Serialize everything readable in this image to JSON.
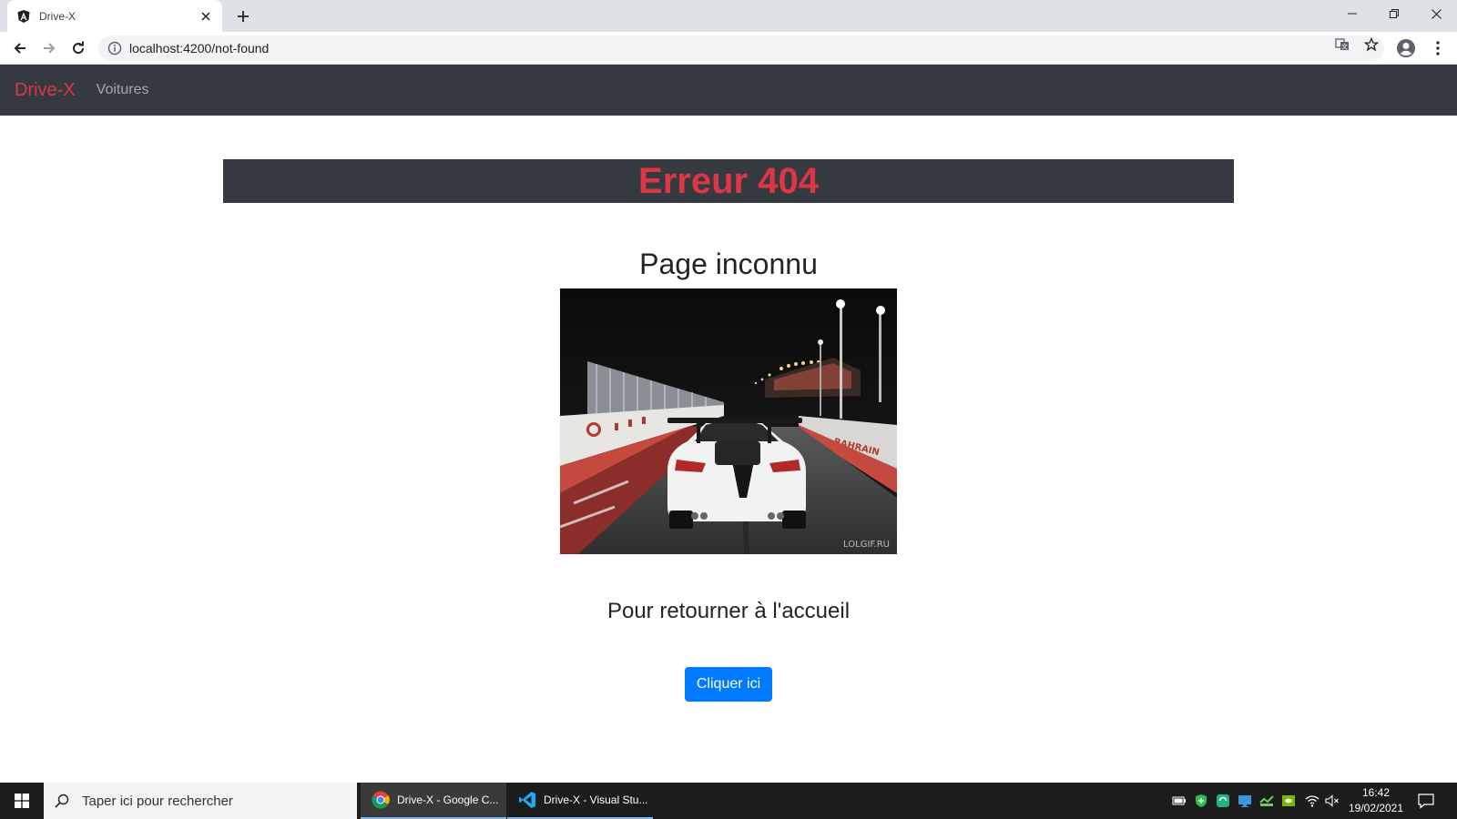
{
  "browser": {
    "tab_title": "Drive-X",
    "url": "localhost:4200/not-found"
  },
  "navbar": {
    "brand": "Drive-X",
    "links": [
      "Voitures"
    ]
  },
  "content": {
    "error_title": "Erreur 404",
    "page_title": "Page inconnu",
    "image_watermark": "LOLGIF.RU",
    "image_sign": "BAHRAIN",
    "return_text": "Pour retourner à l'accueil",
    "button_label": "Cliquer ici"
  },
  "taskbar": {
    "search_placeholder": "Taper ici pour rechercher",
    "apps": [
      {
        "label": "Drive-X - Google C...",
        "icon": "chrome-icon"
      },
      {
        "label": "Drive-X - Visual Stu...",
        "icon": "vscode-icon"
      }
    ],
    "time": "16:42",
    "date": "19/02/2021"
  },
  "colors": {
    "navbar_bg": "#343a40",
    "brand_red": "#dc3545",
    "primary_blue": "#007bff"
  }
}
